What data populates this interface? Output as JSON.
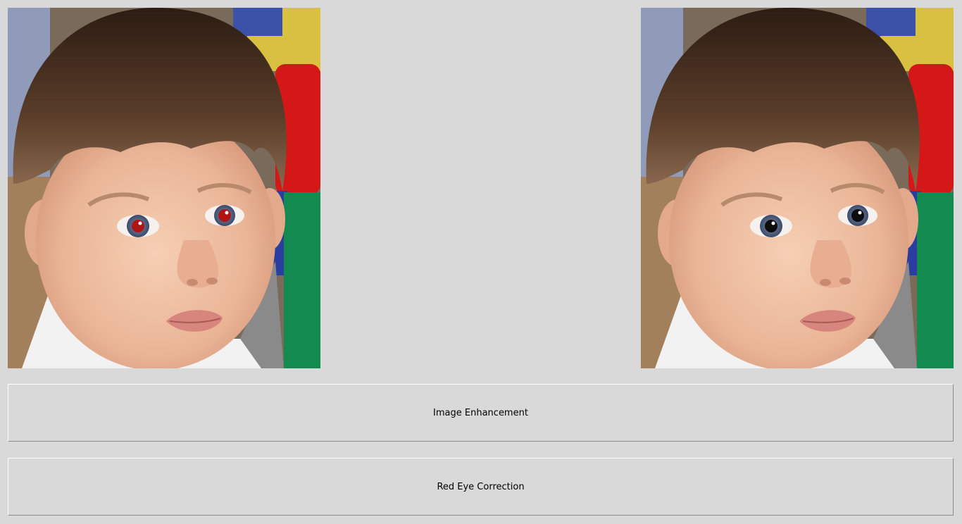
{
  "images": {
    "original": {
      "icon": "child-portrait-red-eye",
      "eye_color": "#b01515"
    },
    "corrected": {
      "icon": "child-portrait-corrected",
      "eye_color": "#0d0d0d"
    }
  },
  "buttons": {
    "enhancement_label": "Image Enhancement",
    "red_eye_label": "Red Eye Correction"
  },
  "colors": {
    "window_bg": "#d9d9d9"
  }
}
